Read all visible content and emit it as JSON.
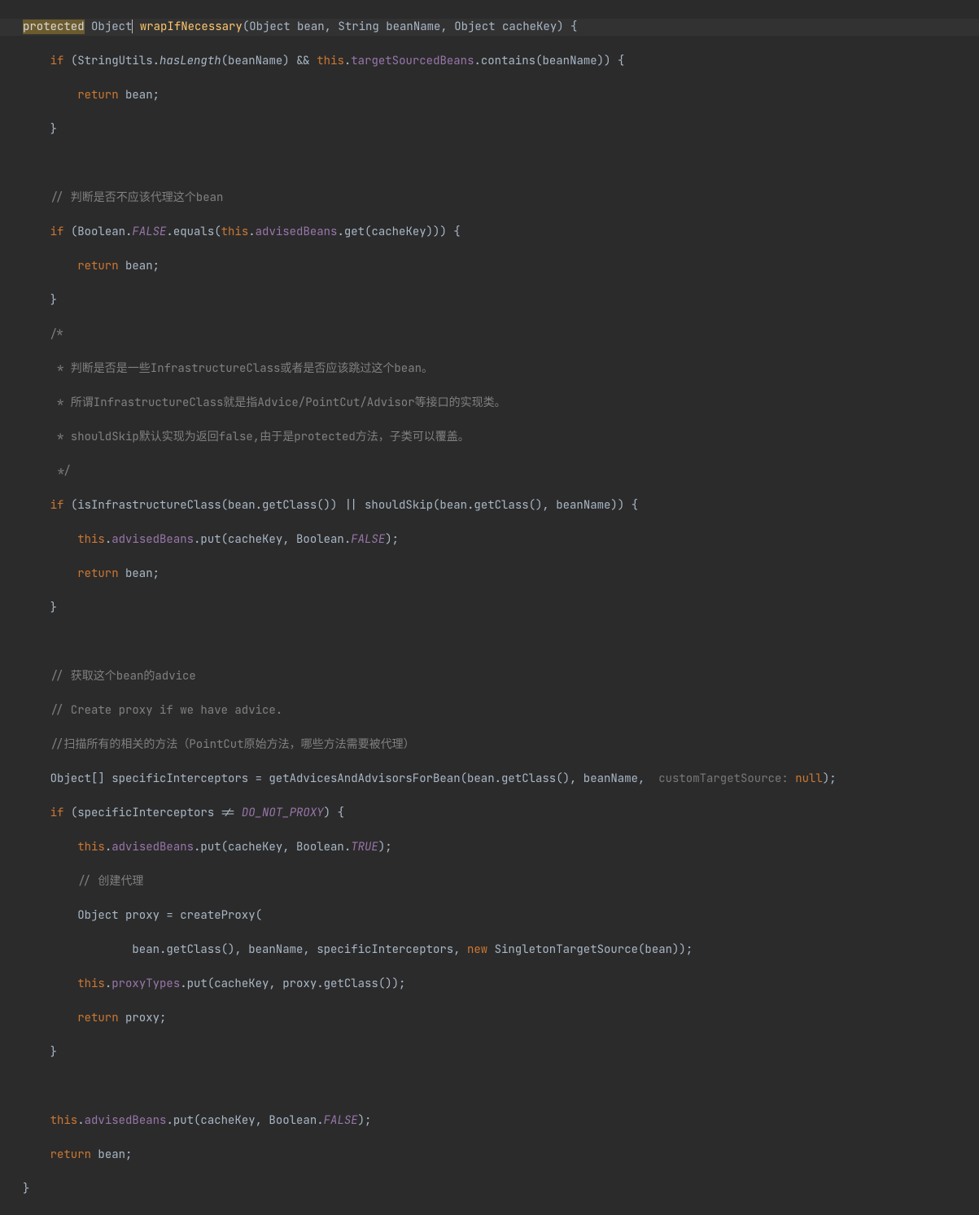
{
  "code": {
    "l1": {
      "protected": "protected",
      "objectType": "Object",
      "methodName": "wrapIfNecessary",
      "params": "(Object bean, String beanName, Object cacheKey) {"
    },
    "l2": {
      "if": "if",
      "open": " (StringUtils.",
      "hasLength": "hasLength",
      "mid": "(beanName) && ",
      "this": "this",
      "dot": ".",
      "field": "targetSourcedBeans",
      "rest": ".contains(beanName)) {"
    },
    "l3": {
      "return": "return",
      "rest": " bean;"
    },
    "l4": "    }",
    "l5": "",
    "l6": "    // 判断是否不应该代理这个bean",
    "l7": {
      "if": "if",
      "open": " (Boolean.",
      "false": "FALSE",
      "eq": ".equals(",
      "this": "this",
      "dot": ".",
      "field": "advisedBeans",
      "rest": ".get(cacheKey))) {"
    },
    "l8": {
      "return": "return",
      "rest": " bean;"
    },
    "l9": "    }",
    "l10": "    /*",
    "l11": "     * 判断是否是一些InfrastructureClass或者是否应该跳过这个bean。",
    "l12": "     * 所谓InfrastructureClass就是指Advice/PointCut/Advisor等接口的实现类。",
    "l13": "     * shouldSkip默认实现为返回false,由于是protected方法，子类可以覆盖。",
    "l14": "     */",
    "l15": {
      "if": "if",
      "rest": " (isInfrastructureClass(bean.getClass()) || shouldSkip(bean.getClass(), beanName)) {"
    },
    "l16": {
      "this": "this",
      "dot": ".",
      "field": "advisedBeans",
      "put": ".put(cacheKey, Boolean.",
      "false": "FALSE",
      "end": ");"
    },
    "l17": {
      "return": "return",
      "rest": " bean;"
    },
    "l18": "    }",
    "l19": "",
    "l20": "    // 获取这个bean的advice",
    "l21": "    // Create proxy if we have advice.",
    "l22": "    //扫描所有的相关的方法（PointCut原始方法，哪些方法需要被代理）",
    "l23": {
      "decl": "Object[] specificInterceptors = getAdvicesAndAdvisorsForBean(bean.getClass(), beanName, ",
      "hint": " customTargetSource: ",
      "null": "null",
      "end": ");"
    },
    "l24": {
      "if": "if",
      "open": " (specificInterceptors != ",
      "const": "DO_NOT_PROXY",
      "end": ") {"
    },
    "l25": {
      "this": "this",
      "dot": ".",
      "field": "advisedBeans",
      "put": ".put(cacheKey, Boolean.",
      "true": "TRUE",
      "end": ");"
    },
    "l26": "        // 创建代理",
    "l27": "        Object proxy = createProxy(",
    "l28": {
      "indent": "                bean.getClass(), beanName, specificInterceptors, ",
      "new": "new",
      "sp": " ",
      "cls": "SingletonTargetSource",
      "end": "(bean));"
    },
    "l29": {
      "this": "this",
      "dot": ".",
      "field": "proxyTypes",
      "put": ".put(cacheKey, proxy.getClass());",
      "end": ""
    },
    "l30": {
      "return": "return",
      "rest": " proxy;"
    },
    "l31": "    }",
    "l32": "",
    "l33": {
      "this": "this",
      "dot": ".",
      "field": "advisedBeans",
      "put": ".put(cacheKey, Boolean.",
      "false": "FALSE",
      "end": ");"
    },
    "l34": {
      "return": "return",
      "rest": " bean;"
    },
    "l35": "}"
  }
}
